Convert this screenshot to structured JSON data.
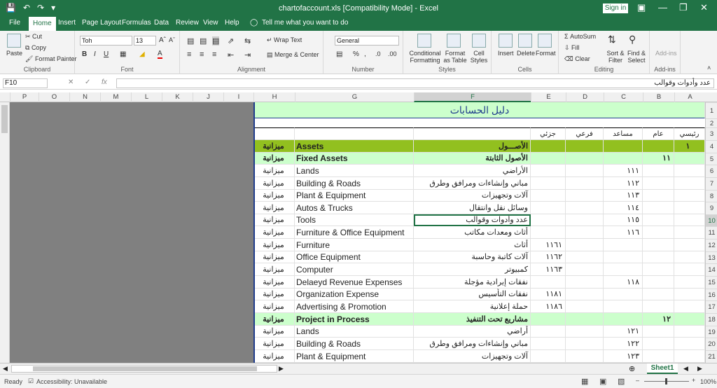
{
  "window": {
    "title": "chartofaccount.xls  [Compatibility Mode]  -  Excel",
    "signin": "Sign in"
  },
  "tabs": [
    "File",
    "Home",
    "Insert",
    "Page Layout",
    "Formulas",
    "Data",
    "Review",
    "View",
    "Help"
  ],
  "tell_me": "Tell me what you want to do",
  "ribbon": {
    "clipboard": {
      "label": "Clipboard",
      "paste": "Paste",
      "cut": "Cut",
      "copy": "Copy",
      "format_painter": "Format Painter"
    },
    "font": {
      "label": "Font",
      "name": "Toh",
      "size": "13"
    },
    "alignment": {
      "label": "Alignment",
      "wrap": "Wrap Text",
      "merge": "Merge & Center"
    },
    "number": {
      "label": "Number",
      "format": "General"
    },
    "styles": {
      "label": "Styles",
      "conditional": "Conditional Formatting",
      "format_table": "Format as Table",
      "cell_styles": "Cell Styles"
    },
    "cells": {
      "label": "Cells",
      "insert": "Insert",
      "delete": "Delete",
      "format": "Format"
    },
    "editing": {
      "label": "Editing",
      "autosum": "AutoSum",
      "fill": "Fill",
      "clear": "Clear",
      "sort": "Sort & Filter",
      "find": "Find & Select"
    },
    "addins": {
      "label": "Add-ins",
      "addins": "Add-ins"
    }
  },
  "formula_bar": {
    "name_box": "F10",
    "fx": "fx",
    "value": "عدد وأدوات وقوالب"
  },
  "columns": [
    "P",
    "O",
    "N",
    "M",
    "L",
    "K",
    "J",
    "I",
    "H",
    "G",
    "F",
    "E",
    "D",
    "C",
    "B",
    "A"
  ],
  "selected_column": "F",
  "rows": [
    "1",
    "2",
    "3",
    "4",
    "5",
    "6",
    "7",
    "8",
    "9",
    "10",
    "11",
    "12",
    "13",
    "14",
    "15",
    "16",
    "17",
    "18",
    "19",
    "20",
    "21"
  ],
  "selected_row": "10",
  "sheet": {
    "title": "دليل الحسابات",
    "headers": {
      "A": "رئيسي",
      "B": "عام",
      "C": "مساعد",
      "D": "فرعي",
      "E": "جزئي"
    },
    "rows": [
      {
        "A": "١",
        "B": "",
        "C": "",
        "D": "",
        "E": "",
        "F": "الأصـــول",
        "G": "Assets",
        "H": "ميزانية",
        "style": "green"
      },
      {
        "A": "",
        "B": "١١",
        "C": "",
        "D": "",
        "E": "",
        "F": "الأصول الثابتة",
        "G": "Fixed Assets",
        "H": "ميزانية",
        "style": "lightgreen"
      },
      {
        "A": "",
        "B": "",
        "C": "١١١",
        "D": "",
        "E": "",
        "F": "الأراضي",
        "G": "Lands",
        "H": "ميزانية",
        "style": ""
      },
      {
        "A": "",
        "B": "",
        "C": "١١٢",
        "D": "",
        "E": "",
        "F": "مباني وإنشاءات ومرافق وطرق",
        "G": "Building & Roads",
        "H": "ميزانية",
        "style": ""
      },
      {
        "A": "",
        "B": "",
        "C": "١١٣",
        "D": "",
        "E": "",
        "F": "آلات وتجهيزات",
        "G": "Plant & Equipment",
        "H": "ميزانية",
        "style": ""
      },
      {
        "A": "",
        "B": "",
        "C": "١١٤",
        "D": "",
        "E": "",
        "F": "وسائل نقل وانتقال",
        "G": "Autos & Trucks",
        "H": "ميزانية",
        "style": ""
      },
      {
        "A": "",
        "B": "",
        "C": "١١٥",
        "D": "",
        "E": "",
        "F": "عدد وأدوات وقوالب",
        "G": "Tools",
        "H": "ميزانية",
        "style": ""
      },
      {
        "A": "",
        "B": "",
        "C": "١١٦",
        "D": "",
        "E": "",
        "F": "أثاث ومعدات مكاتب",
        "G": "Furniture & Office Equipment",
        "H": "ميزانية",
        "style": ""
      },
      {
        "A": "",
        "B": "",
        "C": "",
        "D": "",
        "E": "١١٦١",
        "F": "أثاث",
        "G": "Furniture",
        "H": "ميزانية",
        "style": ""
      },
      {
        "A": "",
        "B": "",
        "C": "",
        "D": "",
        "E": "١١٦٢",
        "F": "آلات كاتبة وحاسبة",
        "G": "Office Equipment",
        "H": "ميزانية",
        "style": ""
      },
      {
        "A": "",
        "B": "",
        "C": "",
        "D": "",
        "E": "١١٦٣",
        "F": "كمبيوتر",
        "G": "Computer",
        "H": "ميزانية",
        "style": ""
      },
      {
        "A": "",
        "B": "",
        "C": "١١٨",
        "D": "",
        "E": "",
        "F": "نفقات إيرادية مؤجلة",
        "G": "Delaeyd Revenue Expenses",
        "H": "ميزانية",
        "style": ""
      },
      {
        "A": "",
        "B": "",
        "C": "",
        "D": "",
        "E": "١١٨١",
        "F": "نفقات التأسيس",
        "G": "Organization Expense",
        "H": "ميزانية",
        "style": ""
      },
      {
        "A": "",
        "B": "",
        "C": "",
        "D": "",
        "E": "١١٨٦",
        "F": "حملة إعلانية",
        "G": "Advertising & Promotion",
        "H": "ميزانية",
        "style": ""
      },
      {
        "A": "",
        "B": "١٢",
        "C": "",
        "D": "",
        "E": "",
        "F": "مشاريع تحت التنفيذ",
        "G": "Project in Process",
        "H": "ميزانية",
        "style": "lightgreen"
      },
      {
        "A": "",
        "B": "",
        "C": "١٢١",
        "D": "",
        "E": "",
        "F": "أراضي",
        "G": "Lands",
        "H": "ميزانية",
        "style": ""
      },
      {
        "A": "",
        "B": "",
        "C": "١٢٢",
        "D": "",
        "E": "",
        "F": "مباني وإنشاءات ومرافق وطرق",
        "G": "Building & Roads",
        "H": "ميزانية",
        "style": ""
      },
      {
        "A": "",
        "B": "",
        "C": "١٢٣",
        "D": "",
        "E": "",
        "F": "آلات وتجهيزات",
        "G": "Plant & Equipment",
        "H": "ميزانية",
        "style": ""
      }
    ]
  },
  "sheet_tab": "Sheet1",
  "status": {
    "ready": "Ready",
    "accessibility": "Accessibility: Unavailable",
    "zoom": "100%"
  },
  "colors": {
    "accent": "#217346",
    "green_row": "#92c01f",
    "lightgreen_row": "#ccffcc",
    "title_fill": "#ccffcc",
    "title_text": "#1f3c8c"
  }
}
